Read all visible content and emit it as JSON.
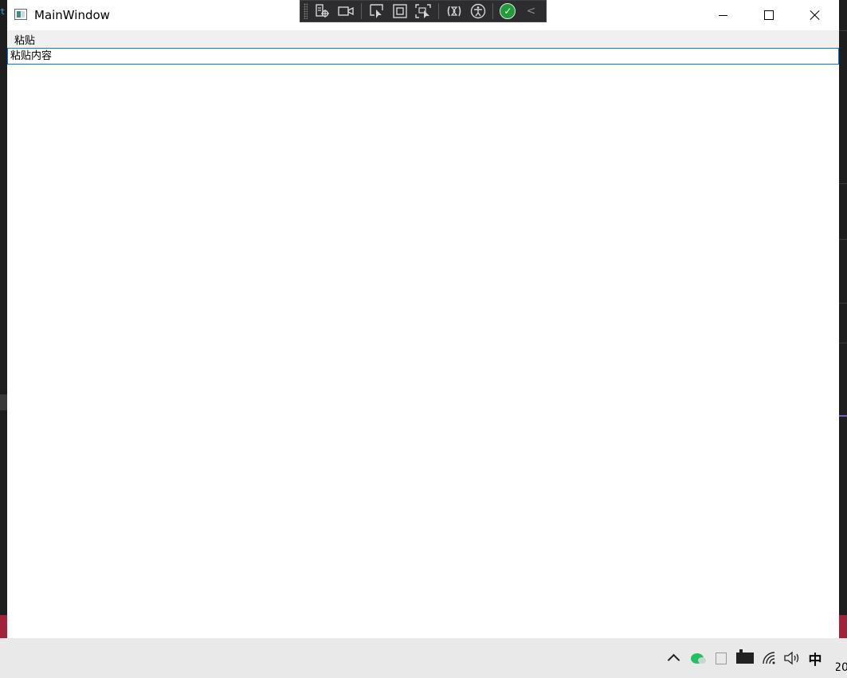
{
  "window": {
    "title": "MainWindow",
    "minimize_icon": "minimize-icon",
    "maximize_icon": "maximize-icon",
    "close_icon": "close-icon"
  },
  "debug_toolbar": {
    "buttons": [
      "live-visual-tree-icon",
      "record-icon",
      "select-element-icon",
      "display-layout-adorners-icon",
      "track-focused-element-icon",
      "hot-reload-icon",
      "accessibility-icon",
      "binding-status-ok-icon",
      "collapse-chevron-icon"
    ],
    "status_color": "#1f9d3a"
  },
  "menubar": {
    "items": [
      {
        "label": "粘贴"
      }
    ]
  },
  "text_input": {
    "value": "粘贴内容",
    "border_color": "#0078d7"
  },
  "background_ide": {
    "left_glyph": "t"
  },
  "taskbar": {
    "tray": {
      "show_hidden_icon": "chevron-up-icon",
      "apps": [
        "wechat-icon",
        "copy-icon",
        "battery-icon",
        "wifi-icon",
        "volume-icon"
      ],
      "ime_label": "中",
      "clock_text": "20"
    }
  }
}
